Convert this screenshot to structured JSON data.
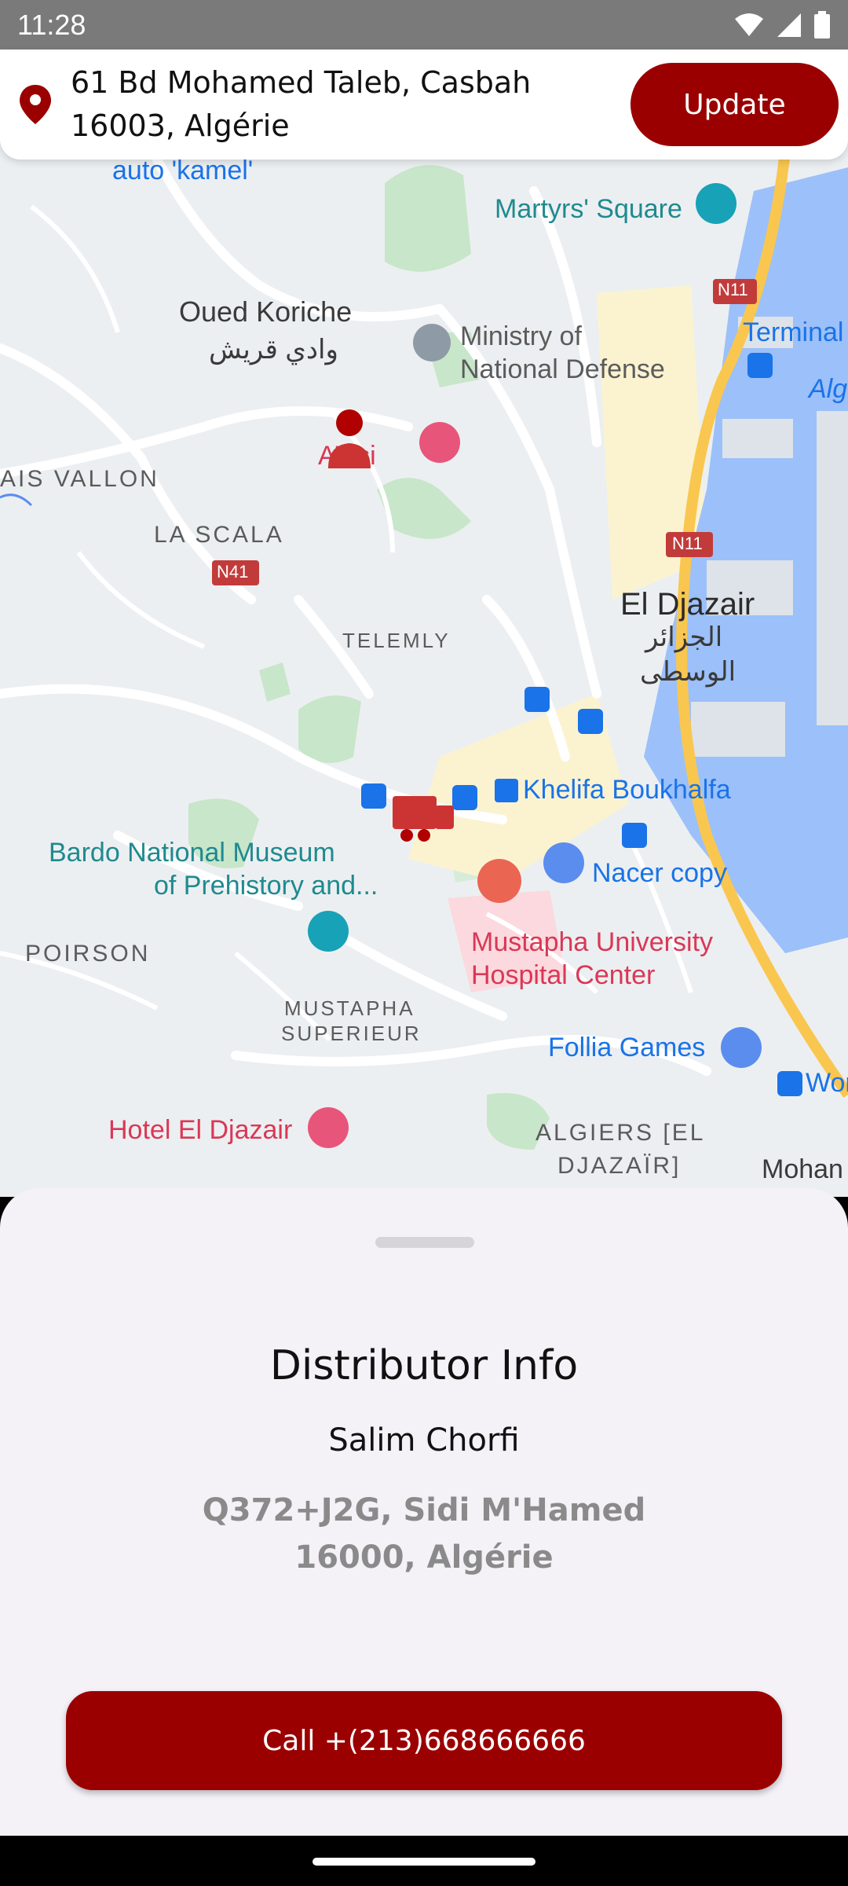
{
  "status_bar": {
    "time": "11:28"
  },
  "header": {
    "address": "61 Bd Mohamed Taleb, Casbah 16003, Algérie",
    "update_label": "Update"
  },
  "map": {
    "labels": {
      "auto_kamel": "auto 'kamel'",
      "martyrs_square": "Martyrs' Square",
      "oued_koriche": "Oued Koriche",
      "oued_koriche_ar": "وادي قريش",
      "ministry": "Ministry of",
      "ministry2": "National Defense",
      "terminal": "Terminal",
      "alg": "Alg",
      "aissi": "Aïssi",
      "ais_vallon": "AIS VALLON",
      "la_scala": "LA SCALA",
      "n41": "N41",
      "n11_top": "N11",
      "n11_mid": "N11",
      "el_djazair": "El Djazair",
      "el_djazair_ar1": "الجزائر",
      "el_djazair_ar2": "الوسطى",
      "telemly": "TELEMLY",
      "khelifa": "Khelifa Boukhalfa",
      "bardo1": "Bardo National Museum",
      "bardo2": "of Prehistory and...",
      "nacer": "Nacer copy",
      "mustapha_hospital1": "Mustapha University",
      "mustapha_hospital2": "Hospital Center",
      "poirson": "POIRSON",
      "mustapha_sup1": "MUSTAPHA",
      "mustapha_sup2": "SUPERIEUR",
      "follia": "Follia Games",
      "wor": "Wor",
      "hotel": "Hotel El Djazair",
      "algiers1": "ALGIERS [EL",
      "algiers2": "DJAZAÏR]",
      "mohan": "Mohan"
    }
  },
  "sheet": {
    "title": "Distributor Info",
    "name": "Salim Chorfi",
    "address": "Q372+J2G, Sidi M'Hamed 16000, Algérie",
    "call_label": "Call +(213)668666666"
  },
  "colors": {
    "accent": "#9b0000",
    "sea": "#9cc0f9",
    "park": "#c8e6c9",
    "road_major": "#f9c74f",
    "map_bg": "#eceff1"
  }
}
